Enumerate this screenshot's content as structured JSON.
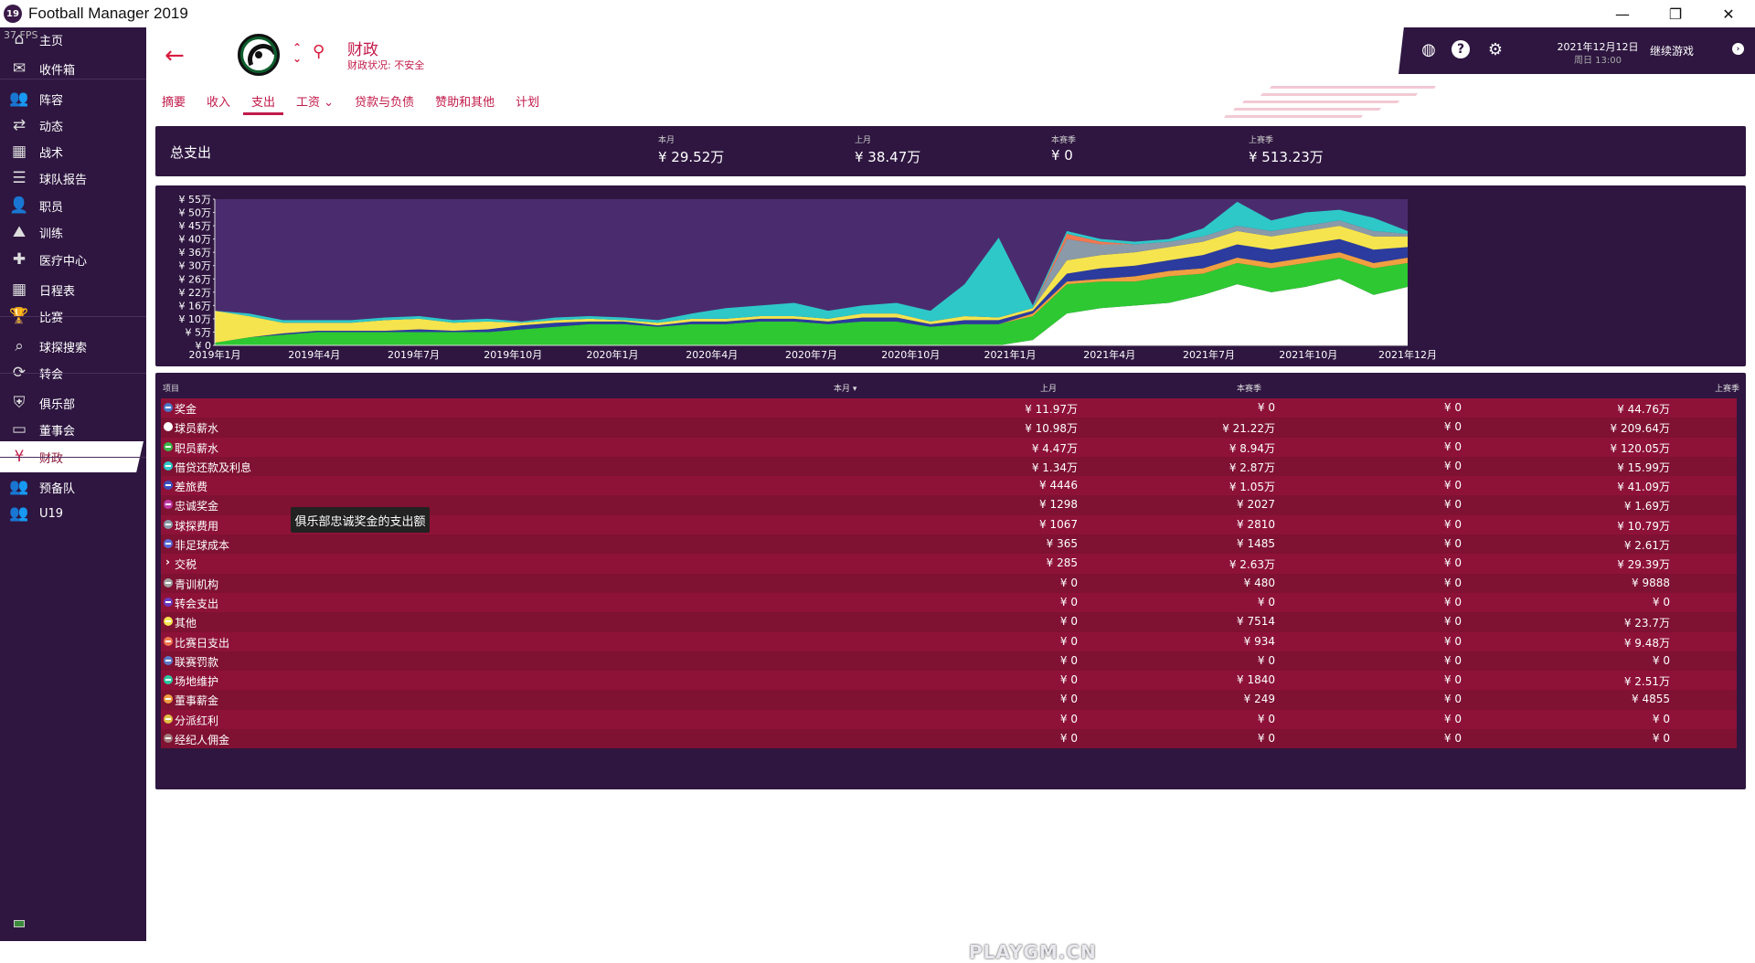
{
  "app": {
    "title": "Football Manager 2019",
    "logo_text": "19",
    "fps": "37 FPS",
    "window_buttons": [
      "—",
      "❐",
      "✕"
    ]
  },
  "sidebar": {
    "items": [
      {
        "label": "主页",
        "icon": "home-icon",
        "glyph": "⌂"
      },
      {
        "label": "收件箱",
        "icon": "inbox-icon",
        "glyph": "✉"
      },
      {
        "label": "阵容",
        "icon": "squad-icon",
        "glyph": "👥"
      },
      {
        "label": "动态",
        "icon": "dynamics-icon",
        "glyph": "⇄"
      },
      {
        "label": "战术",
        "icon": "tactics-icon",
        "glyph": "▦"
      },
      {
        "label": "球队报告",
        "icon": "report-icon",
        "glyph": "☰"
      },
      {
        "label": "职员",
        "icon": "staff-icon",
        "glyph": "👤"
      },
      {
        "label": "训练",
        "icon": "training-icon",
        "glyph": "⛰"
      },
      {
        "label": "医疗中心",
        "icon": "medical-icon",
        "glyph": "✚"
      },
      {
        "label": "日程表",
        "icon": "calendar-icon",
        "glyph": "▦"
      },
      {
        "label": "比赛",
        "icon": "trophy-icon",
        "glyph": "🏆"
      },
      {
        "label": "球探搜索",
        "icon": "scouting-icon",
        "glyph": "⌕"
      },
      {
        "label": "转会",
        "icon": "transfers-icon",
        "glyph": "⟳"
      },
      {
        "label": "俱乐部",
        "icon": "club-icon",
        "glyph": "⛨"
      },
      {
        "label": "董事会",
        "icon": "board-icon",
        "glyph": "▭"
      },
      {
        "label": "财政",
        "icon": "finances-icon",
        "glyph": "¥",
        "active": true
      },
      {
        "label": "预备队",
        "icon": "reserve-icon",
        "glyph": "👥"
      },
      {
        "label": "U19",
        "icon": "u19-icon",
        "glyph": "👥"
      }
    ]
  },
  "header": {
    "title": "财政",
    "subtitle": "财政状况: 不安全",
    "tabs": [
      {
        "label": "摘要"
      },
      {
        "label": "收入"
      },
      {
        "label": "支出",
        "active": true
      },
      {
        "label": "工资 ⌄"
      },
      {
        "label": "贷款与负债"
      },
      {
        "label": "赞助和其他"
      },
      {
        "label": "计划"
      }
    ]
  },
  "topbar": {
    "date": "2021年12月12日",
    "time": "周日 13:00",
    "continue_label": "继续游戏"
  },
  "summary": {
    "title": "总支出",
    "columns": [
      {
        "caption": "本月",
        "value": "¥ 29.52万"
      },
      {
        "caption": "上月",
        "value": "¥ 38.47万"
      },
      {
        "caption": "本赛季",
        "value": "¥ 0"
      },
      {
        "caption": "上赛季",
        "value": "¥ 513.23万"
      }
    ]
  },
  "chart_data": {
    "type": "area",
    "y_tick_labels": [
      "¥ 0",
      "¥ 5万",
      "¥ 10万",
      "¥ 16万",
      "¥ 22万",
      "¥ 26万",
      "¥ 30万",
      "¥ 36万",
      "¥ 40万",
      "¥ 45万",
      "¥ 50万",
      "¥ 55万"
    ],
    "ylim": [
      0,
      55
    ],
    "x_tick_labels": [
      "2019年1月",
      "2019年4月",
      "2019年7月",
      "2019年10月",
      "2020年1月",
      "2020年4月",
      "2020年7月",
      "2020年10月",
      "2021年1月",
      "2021年4月",
      "2021年7月",
      "2021年10月",
      "2021年12月"
    ],
    "x": [
      "2019-01",
      "2019-02",
      "2019-03",
      "2019-04",
      "2019-05",
      "2019-06",
      "2019-07",
      "2019-08",
      "2019-09",
      "2019-10",
      "2019-11",
      "2019-12",
      "2020-01",
      "2020-02",
      "2020-03",
      "2020-04",
      "2020-05",
      "2020-06",
      "2020-07",
      "2020-08",
      "2020-09",
      "2020-10",
      "2020-11",
      "2020-12",
      "2021-01",
      "2021-02",
      "2021-03",
      "2021-04",
      "2021-05",
      "2021-06",
      "2021-07",
      "2021-08",
      "2021-09",
      "2021-10",
      "2021-11",
      "2021-12"
    ],
    "series": [
      {
        "color": "#ffffff",
        "values": [
          0,
          0,
          0,
          0,
          0,
          0,
          0,
          0,
          0,
          0,
          0,
          0,
          0,
          0,
          0,
          0,
          0,
          0,
          0,
          0,
          0,
          0,
          0,
          0,
          2,
          12,
          14,
          15,
          16,
          19,
          23,
          20,
          22,
          25,
          19,
          22
        ]
      },
      {
        "color": "#2ec832",
        "values": [
          1,
          3,
          4,
          5,
          5,
          5,
          5,
          5,
          5,
          6,
          7,
          8,
          8,
          7,
          8,
          8,
          9,
          9,
          8,
          9,
          9,
          7,
          8,
          8,
          9,
          11,
          10,
          9,
          10,
          8,
          8,
          9,
          9,
          8,
          10,
          9
        ]
      },
      {
        "color": "#f0a040",
        "values": [
          0,
          0,
          0,
          0,
          0,
          0,
          0,
          0,
          0,
          0,
          0,
          0,
          0,
          0,
          0,
          0,
          0,
          0,
          0,
          0,
          0,
          0,
          0,
          0,
          1,
          1,
          1,
          2,
          2,
          2,
          2,
          2,
          2,
          2,
          2,
          2
        ]
      },
      {
        "color": "#2b3c9e",
        "values": [
          0,
          0,
          0.5,
          0.5,
          0.5,
          0.5,
          1,
          0.5,
          1,
          1.5,
          1.5,
          1,
          1,
          0.5,
          1,
          1,
          1,
          1,
          1,
          1.5,
          1.5,
          1,
          1.5,
          1.5,
          1,
          3,
          4,
          4,
          4,
          5,
          5,
          5,
          5,
          5,
          5,
          4
        ]
      },
      {
        "color": "#f5e44e",
        "values": [
          12,
          8,
          4,
          3,
          3,
          4,
          4,
          3,
          3,
          1,
          1,
          1,
          0.5,
          1,
          1,
          1,
          1,
          1,
          1,
          1.5,
          1.5,
          1,
          1.5,
          1,
          1,
          5,
          5,
          5,
          5,
          5,
          5,
          5,
          5,
          5,
          5,
          4
        ]
      },
      {
        "color": "#8a9aa8",
        "values": [
          0,
          0,
          0,
          0,
          0,
          0,
          0,
          0,
          0,
          0,
          0,
          0,
          0,
          0,
          0,
          0,
          0,
          0,
          0,
          0,
          0,
          0,
          0,
          0,
          0,
          8,
          4,
          3,
          2,
          2,
          2,
          2,
          2,
          2,
          2,
          1
        ]
      },
      {
        "color": "#f07850",
        "values": [
          0,
          0,
          0,
          0,
          0,
          0,
          0,
          0,
          0,
          0,
          0,
          0,
          0,
          0,
          0,
          0,
          0,
          0,
          0,
          0,
          0,
          0,
          0,
          0,
          0,
          2,
          1,
          0,
          0,
          0,
          0,
          0,
          0,
          0,
          0,
          0
        ]
      },
      {
        "color": "#2ec8c8",
        "values": [
          0,
          1,
          1,
          1,
          1,
          1,
          1,
          1,
          1,
          0.5,
          1,
          1,
          1,
          1,
          2,
          4,
          4,
          5,
          3,
          3,
          4,
          4,
          12,
          30,
          1,
          1,
          1,
          1,
          1,
          3,
          9,
          4,
          5,
          4,
          5,
          1
        ]
      }
    ]
  },
  "table": {
    "headers": {
      "item": "项目",
      "this_month": "本月 ▾",
      "last_month": "上月",
      "this_season": "本赛季",
      "last_season": "上赛季"
    },
    "rows": [
      {
        "name": "奖金",
        "icon_color": "#4a78c8",
        "this_month": "¥ 11.97万",
        "last_month": "¥ 0",
        "this_season": "¥ 0",
        "last_season": "¥ 44.76万"
      },
      {
        "name": "球员薪水",
        "icon_color": "#ffffff",
        "this_month": "¥ 10.98万",
        "last_month": "¥ 21.22万",
        "this_season": "¥ 0",
        "last_season": "¥ 209.64万"
      },
      {
        "name": "职员薪水",
        "icon_color": "#3ab84a",
        "this_month": "¥ 4.47万",
        "last_month": "¥ 8.94万",
        "this_season": "¥ 0",
        "last_season": "¥ 120.05万"
      },
      {
        "name": "借贷还款及利息",
        "icon_color": "#2ec8c8",
        "this_month": "¥ 1.34万",
        "last_month": "¥ 2.87万",
        "this_season": "¥ 0",
        "last_season": "¥ 15.99万"
      },
      {
        "name": "差旅费",
        "icon_color": "#3a50c0",
        "this_month": "¥ 4446",
        "last_month": "¥ 1.05万",
        "this_season": "¥ 0",
        "last_season": "¥ 41.09万"
      },
      {
        "name": "忠诚奖金",
        "icon_color": "#c03aa8",
        "this_month": "¥ 1298",
        "last_month": "¥ 2027",
        "this_season": "¥ 0",
        "last_season": "¥ 1.69万"
      },
      {
        "name": "球探费用",
        "icon_color": "#8a9aa8",
        "this_month": "¥ 1067",
        "last_month": "¥ 2810",
        "this_season": "¥ 0",
        "last_season": "¥ 10.79万"
      },
      {
        "name": "非足球成本",
        "icon_color": "#5a6ad8",
        "this_month": "¥ 365",
        "last_month": "¥ 1485",
        "this_season": "¥ 0",
        "last_season": "¥ 2.61万"
      },
      {
        "name": "交税",
        "icon_color": "",
        "chevron": "›",
        "this_month": "¥ 285",
        "last_month": "¥ 2.63万",
        "this_season": "¥ 0",
        "last_season": "¥ 29.39万"
      },
      {
        "name": "青训机构",
        "icon_color": "#a0a0a0",
        "this_month": "¥ 0",
        "last_month": "¥ 480",
        "this_season": "¥ 0",
        "last_season": "¥ 9888"
      },
      {
        "name": "转会支出",
        "icon_color": "#6a3ac0",
        "this_month": "¥ 0",
        "last_month": "¥ 0",
        "this_season": "¥ 0",
        "last_season": "¥ 0"
      },
      {
        "name": "其他",
        "icon_color": "#f5e44e",
        "this_month": "¥ 0",
        "last_month": "¥ 7514",
        "this_season": "¥ 0",
        "last_season": "¥ 23.7万"
      },
      {
        "name": "比赛日支出",
        "icon_color": "#f07850",
        "this_month": "¥ 0",
        "last_month": "¥ 934",
        "this_season": "¥ 0",
        "last_season": "¥ 9.48万"
      },
      {
        "name": "联赛罚款",
        "icon_color": "#5a7ac8",
        "this_month": "¥ 0",
        "last_month": "¥ 0",
        "this_season": "¥ 0",
        "last_season": "¥ 0"
      },
      {
        "name": "场地维护",
        "icon_color": "#2ec8a0",
        "this_month": "¥ 0",
        "last_month": "¥ 1840",
        "this_season": "¥ 0",
        "last_season": "¥ 2.51万"
      },
      {
        "name": "董事薪金",
        "icon_color": "#f0a040",
        "this_month": "¥ 0",
        "last_month": "¥ 249",
        "this_season": "¥ 0",
        "last_season": "¥ 4855"
      },
      {
        "name": "分派红利",
        "icon_color": "#e0c040",
        "this_month": "¥ 0",
        "last_month": "¥ 0",
        "this_season": "¥ 0",
        "last_season": "¥ 0"
      },
      {
        "name": "经纪人佣金",
        "icon_color": "#a07a7a",
        "this_month": "¥ 0",
        "last_month": "¥ 0",
        "this_season": "¥ 0",
        "last_season": "¥ 0"
      }
    ]
  },
  "tooltip": "俱乐部忠诚奖金的支出额",
  "watermark": "PLAYGM.CN"
}
